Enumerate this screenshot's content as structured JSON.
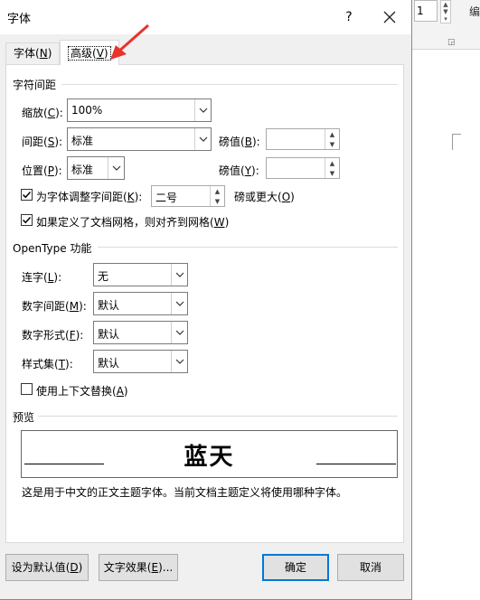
{
  "background": {
    "font_size_box": "1",
    "bian_label": "编"
  },
  "dialog": {
    "title": "字体",
    "help": "?",
    "tabs": [
      {
        "label": "字体",
        "key": "N"
      },
      {
        "label": "高级",
        "key": "V"
      }
    ],
    "spacing_section": {
      "title": "字符间距",
      "scale": {
        "label": "缩放",
        "key": "C",
        "value": "100%"
      },
      "spacing": {
        "label": "间距",
        "key": "S",
        "value": "标准",
        "pts_label": "磅值",
        "pts_key": "B",
        "pts_value": ""
      },
      "position": {
        "label": "位置",
        "key": "P",
        "value": "标准",
        "pts_label": "磅值",
        "pts_key": "Y",
        "pts_value": ""
      },
      "kerning": {
        "label": "为字体调整字间距",
        "key": "K",
        "checked": true,
        "value": "二号",
        "suffix": "磅或更大",
        "suffix_key": "O"
      },
      "snap_grid": {
        "label": "如果定义了文档网格，则对齐到网格",
        "key": "W",
        "checked": true
      }
    },
    "opentype_section": {
      "title": "OpenType 功能",
      "ligatures": {
        "label": "连字",
        "key": "L",
        "value": "无"
      },
      "number_spacing": {
        "label": "数字间距",
        "key": "M",
        "value": "默认"
      },
      "number_forms": {
        "label": "数字形式",
        "key": "F",
        "value": "默认"
      },
      "stylistic_sets": {
        "label": "样式集",
        "key": "T",
        "value": "默认"
      },
      "contextual": {
        "label": "使用上下文替换",
        "key": "A",
        "checked": false
      }
    },
    "preview": {
      "title": "预览",
      "sample": "蓝天",
      "note": "这是用于中文的正文主题字体。当前文档主题定义将使用哪种字体。"
    },
    "buttons": {
      "set_default": {
        "label": "设为默认值",
        "key": "D"
      },
      "text_effects": {
        "label": "文字效果",
        "key": "E",
        "suffix": "..."
      },
      "ok": "确定",
      "cancel": "取消"
    },
    "colors": {
      "accent": "#0078d7",
      "arrow": "#e8332b",
      "dialog_bg": "#f0f0f0"
    }
  }
}
